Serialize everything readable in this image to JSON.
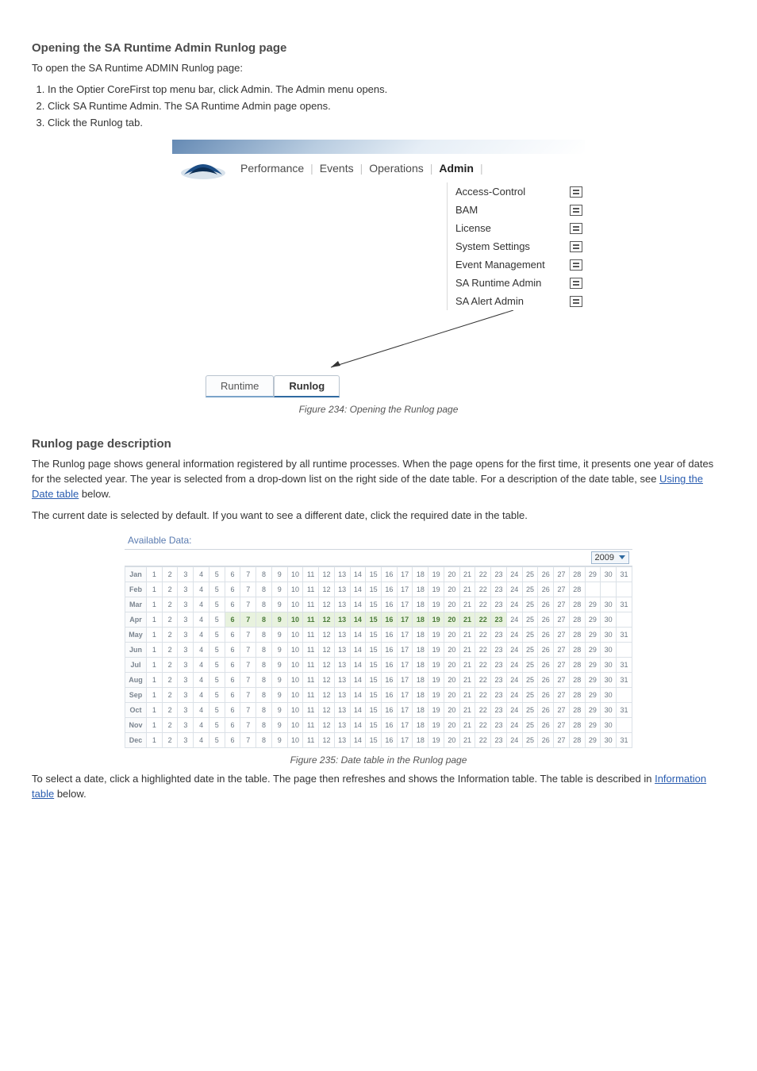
{
  "sections": {
    "h_open": "Opening the SA Runtime Admin Runlog page",
    "h_desc": "Runlog page description"
  },
  "open_intro": "To open the SA Runtime ADMIN Runlog page:",
  "open_steps": [
    "In the Optier CoreFirst top menu bar, click Admin. The Admin menu opens.",
    "Click SA Runtime Admin. The SA Runtime Admin page opens.",
    "Click the Runlog tab."
  ],
  "fig1": {
    "nav": [
      "Performance",
      "Events",
      "Operations",
      "Admin"
    ],
    "active_nav": "Admin",
    "menu": [
      "Access-Control",
      "BAM",
      "License",
      "System Settings",
      "Event Management",
      "SA Runtime Admin",
      "SA Alert Admin"
    ],
    "tabs": [
      "Runtime",
      "Runlog"
    ],
    "active_tab": "Runlog",
    "caption": "Figure 234: Opening the Runlog page"
  },
  "desc_p1_a": "The Runlog page shows general information registered by all runtime processes. When the page opens for the first time, it presents one year of dates for the selected year. The year is selected from a drop-down list on the right side of the date table. For a description of the date table, see ",
  "desc_p1_link": "Using the Date table",
  "desc_p1_b": " below.",
  "desc_p2": "The current date is selected by default. If you want to see a different date, click the required date in the table.",
  "fig2": {
    "title": "Available Data:",
    "year": "2009",
    "months": [
      "Jan",
      "Feb",
      "Mar",
      "Apr",
      "May",
      "Jun",
      "Jul",
      "Aug",
      "Sep",
      "Oct",
      "Nov",
      "Dec"
    ],
    "days_in_month": [
      31,
      28,
      31,
      30,
      31,
      30,
      31,
      31,
      30,
      31,
      30,
      31
    ],
    "green_ranges": {
      "Apr": [
        6,
        23
      ]
    },
    "caption": "Figure 235: Date table in the Runlog page"
  },
  "desc_p3_a": "To select a date, click a highlighted date in the table. The page then refreshes and shows the Information table. The table is described in ",
  "desc_p3_link": "Information table",
  "desc_p3_b": " below.",
  "chart_data": {
    "type": "table",
    "title": "Available Data calendar",
    "year": 2009,
    "rows": [
      "Jan",
      "Feb",
      "Mar",
      "Apr",
      "May",
      "Jun",
      "Jul",
      "Aug",
      "Sep",
      "Oct",
      "Nov",
      "Dec"
    ],
    "columns_range": [
      1,
      31
    ],
    "highlighted": {
      "Apr": [
        6,
        7,
        8,
        9,
        10,
        11,
        12,
        13,
        14,
        15,
        16,
        17,
        18,
        19,
        20,
        21,
        22,
        23
      ]
    }
  }
}
